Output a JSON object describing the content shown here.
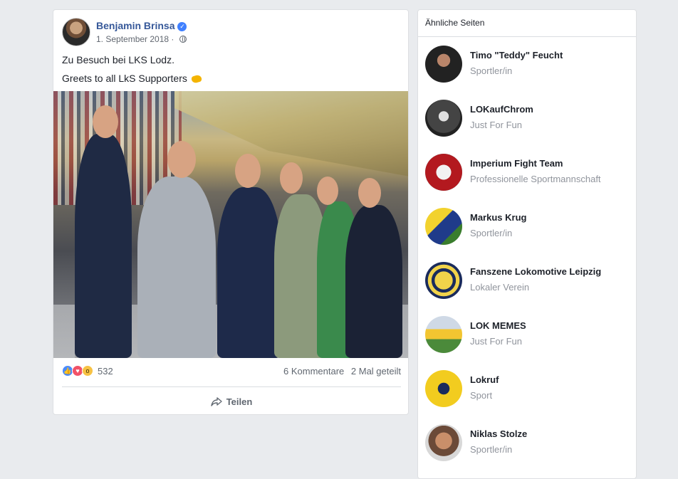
{
  "post": {
    "author": "Benjamin Brinsa",
    "date": "1. September 2018",
    "privacy_icon": "globe-icon",
    "text_line1": "Zu Besuch bei LKS Lodz.",
    "text_line2": "Greets to all LkS Supporters",
    "text_emoji": "handshake-emoji",
    "reaction_count": "532",
    "comments": "6 Kommentare",
    "shares": "2 Mal geteilt",
    "share_label": "Teilen"
  },
  "sidebar": {
    "title": "Ähnliche Seiten",
    "pages": [
      {
        "name": "Timo \"Teddy\" Feucht",
        "category": "Sportler/in"
      },
      {
        "name": "LOKaufChrom",
        "category": "Just For Fun"
      },
      {
        "name": "Imperium Fight Team",
        "category": "Professionelle Sportmannschaft"
      },
      {
        "name": "Markus Krug",
        "category": "Sportler/in"
      },
      {
        "name": "Fanszene Lokomotive Leipzig",
        "category": "Lokaler Verein"
      },
      {
        "name": "LOK MEMES",
        "category": "Just For Fun"
      },
      {
        "name": "Lokruf",
        "category": "Sport"
      },
      {
        "name": "Niklas Stolze",
        "category": "Sportler/in"
      }
    ]
  },
  "colors": {
    "background": "#e9ebee",
    "link_blue": "#365899",
    "secondary_text": "#90949c"
  }
}
